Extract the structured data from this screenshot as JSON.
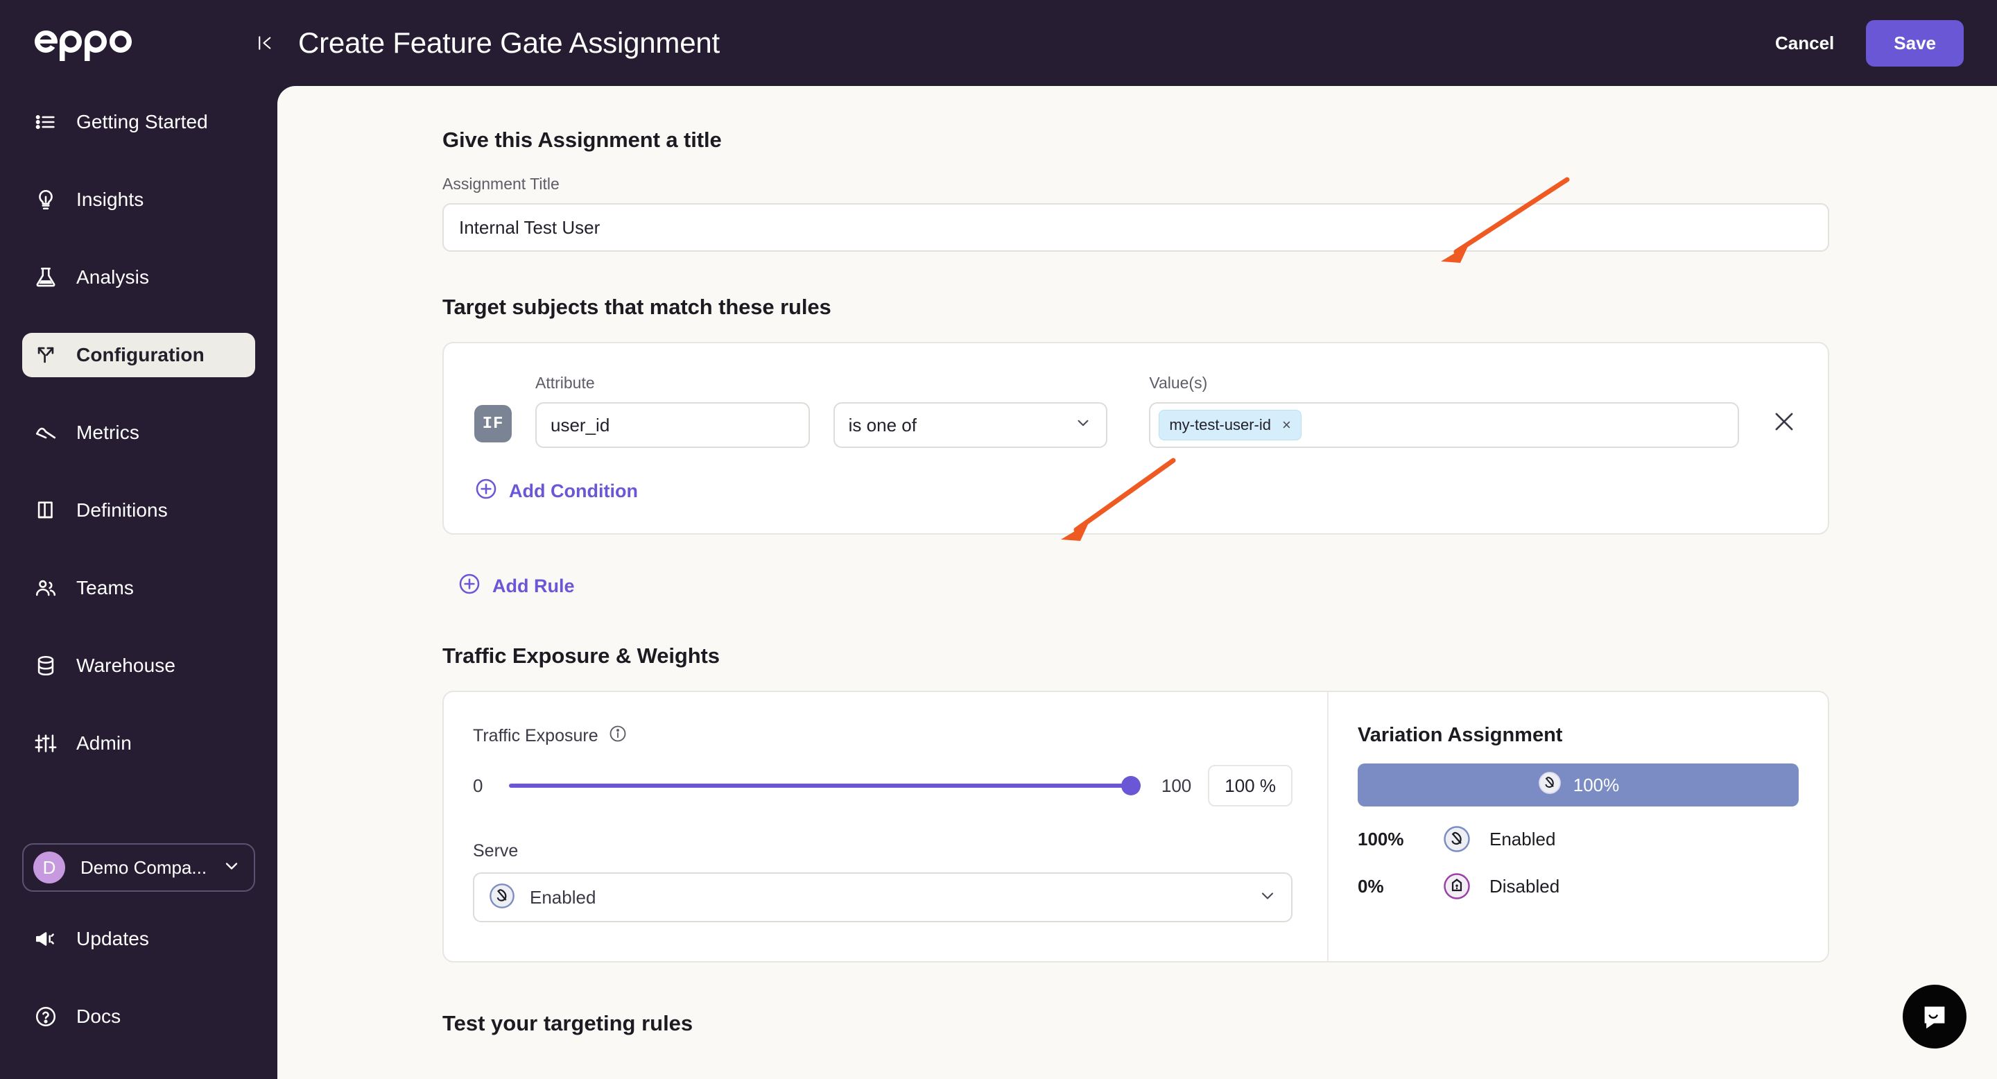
{
  "brand": {
    "logo_text": "eppo",
    "accent": "#6a57d5",
    "sidebar_bg": "#261d32"
  },
  "sidebar": {
    "collapse_icon": "collapse-panel-icon",
    "items": [
      {
        "label": "Getting Started",
        "icon": "list-icon",
        "active": false
      },
      {
        "label": "Insights",
        "icon": "lightbulb-icon",
        "active": false
      },
      {
        "label": "Analysis",
        "icon": "flask-icon",
        "active": false
      },
      {
        "label": "Configuration",
        "icon": "branch-icon",
        "active": true
      },
      {
        "label": "Metrics",
        "icon": "chart-line-icon",
        "active": false
      },
      {
        "label": "Definitions",
        "icon": "book-icon",
        "active": false
      },
      {
        "label": "Teams",
        "icon": "people-icon",
        "active": false
      },
      {
        "label": "Warehouse",
        "icon": "database-icon",
        "active": false
      },
      {
        "label": "Admin",
        "icon": "sliders-icon",
        "active": false
      }
    ],
    "org": {
      "initial": "D",
      "name": "Demo Compa...",
      "chevron": "chevron-down-icon"
    },
    "bottom_items": [
      {
        "label": "Updates",
        "icon": "megaphone-icon"
      },
      {
        "label": "Docs",
        "icon": "question-circle-icon"
      }
    ]
  },
  "header": {
    "title": "Create Feature Gate Assignment",
    "cancel_label": "Cancel",
    "save_label": "Save"
  },
  "title_section": {
    "heading": "Give this Assignment a title",
    "field_label": "Assignment Title",
    "value": "Internal Test User",
    "placeholder": "Assignment Title"
  },
  "rules_section": {
    "heading": "Target subjects that match these rules",
    "if_badge": "IF",
    "attribute_label": "Attribute",
    "attribute_value": "user_id",
    "operator_value": "is one of",
    "values_label": "Value(s)",
    "value_chips": [
      "my-test-user-id"
    ],
    "chip_remove": "×",
    "remove_condition_icon": "close-icon",
    "add_condition_label": "Add Condition",
    "add_rule_label": "Add Rule"
  },
  "traffic_section": {
    "heading": "Traffic Exposure & Weights",
    "exposure_label": "Traffic Exposure",
    "info_icon": "info-icon",
    "slider_min": "0",
    "slider_max": "100",
    "slider_value": 100,
    "percent_box": "100 %",
    "serve_label": "Serve",
    "serve_value": "Enabled",
    "serve_chevron": "chevron-down-icon"
  },
  "variation_panel": {
    "title": "Variation Assignment",
    "bar_label": "100%",
    "bar_color": "#7b8cc4",
    "rows": [
      {
        "percent": "100%",
        "name": "Enabled",
        "icon": "enabled-variation-icon"
      },
      {
        "percent": "0%",
        "name": "Disabled",
        "icon": "disabled-variation-icon"
      }
    ]
  },
  "test_section": {
    "heading": "Test your targeting rules"
  },
  "chat": {
    "icon": "intercom-chat-icon"
  }
}
